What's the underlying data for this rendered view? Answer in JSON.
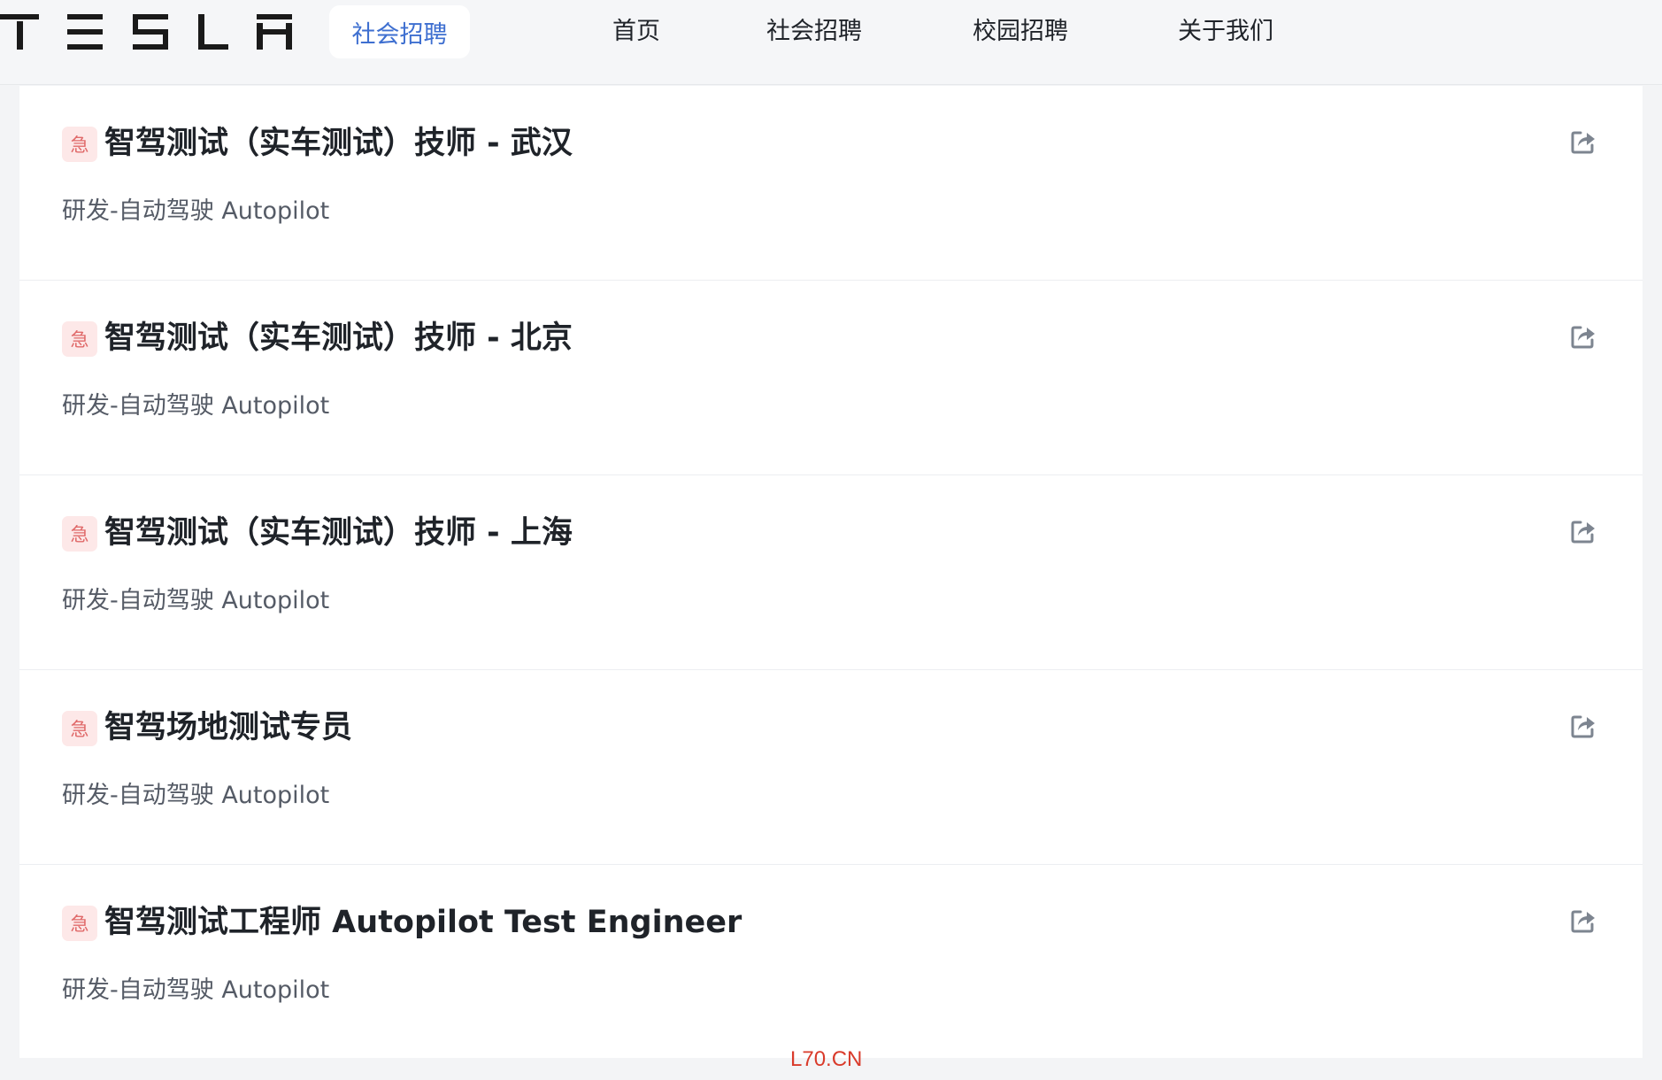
{
  "header": {
    "logo_text": "TESLA",
    "active_tab": "社会招聘",
    "nav": [
      "首页",
      "社会招聘",
      "校园招聘",
      "关于我们"
    ]
  },
  "jobs": [
    {
      "urgent": "急",
      "title": "智驾测试（实车测试）技师 - 武汉",
      "dept": "研发-自动驾驶 Autopilot",
      "share_icon": "share-icon"
    },
    {
      "urgent": "急",
      "title": "智驾测试（实车测试）技师 - 北京",
      "dept": "研发-自动驾驶 Autopilot",
      "share_icon": "share-icon"
    },
    {
      "urgent": "急",
      "title": "智驾测试（实车测试）技师 - 上海",
      "dept": "研发-自动驾驶 Autopilot",
      "share_icon": "share-icon"
    },
    {
      "urgent": "急",
      "title": "智驾场地测试专员",
      "dept": "研发-自动驾驶 Autopilot",
      "share_icon": "share-icon"
    },
    {
      "urgent": "急",
      "title": "智驾测试工程师 Autopilot Test Engineer",
      "dept": "研发-自动驾驶 Autopilot",
      "share_icon": "share-icon"
    }
  ],
  "watermark": "L70.CN",
  "colors": {
    "accent": "#3e6fd0",
    "urgent_bg": "#fde8e8",
    "urgent_text": "#e06a6a",
    "watermark": "#d93b2b"
  }
}
